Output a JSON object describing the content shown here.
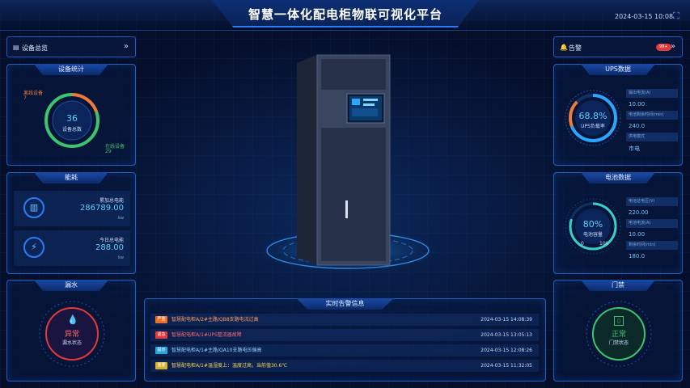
{
  "header": {
    "title": "智慧一体化配电柜物联可视化平台",
    "datetime": "2024-03-15 10:08"
  },
  "overview": {
    "label": "设备总览"
  },
  "device_stats": {
    "title": "设备统计",
    "total": "36",
    "total_label": "设备总数",
    "offline_label": "离线设备",
    "offline_count": "7",
    "online_label": "在线设备",
    "online_count": "29"
  },
  "energy": {
    "title": "能耗",
    "cumulative_label": "累加总电能",
    "cumulative_value": "286789.00",
    "cumulative_unit": "kw",
    "today_label": "今日总电能",
    "today_value": "288.00",
    "today_unit": "kw"
  },
  "leak": {
    "title": "漏水",
    "status": "异常",
    "status_label": "漏水状态"
  },
  "alarm": {
    "label": "告警",
    "badge": "99+"
  },
  "ups": {
    "title": "UPS数据",
    "percent": "68.8%",
    "percent_label": "UPS负载率",
    "fields": [
      {
        "label": "输出电流(A)",
        "value": "10.00"
      },
      {
        "label": "电池剩余时间(min)",
        "value": "240.0"
      },
      {
        "label": "供电模式",
        "value": "市电"
      }
    ]
  },
  "battery": {
    "title": "电池数据",
    "percent": "80%",
    "percent_label": "电池容量",
    "scale_min": "0",
    "scale_max": "100",
    "fields": [
      {
        "label": "电池总电压(V)",
        "value": "220.00"
      },
      {
        "label": "电池电流(A)",
        "value": "10.00"
      },
      {
        "label": "剩余时间(min)",
        "value": "180.0"
      }
    ]
  },
  "door": {
    "title": "门禁",
    "status": "正常",
    "status_label": "门禁状态"
  },
  "realtime": {
    "title": "实时告警信息",
    "rows": [
      {
        "tag": "严重",
        "color": "#e8722a",
        "text": "智慧配电柜A/2#主路/QB8支路电流过高",
        "time": "2024-03-15 14:08:39",
        "text_color": "#ff9e5a"
      },
      {
        "tag": "紧急",
        "color": "#e23a3a",
        "text": "智慧配电柜A/1#UPS整流器故障",
        "time": "2024-03-15 13:05:13",
        "text_color": "#ff6b6b"
      },
      {
        "tag": "提示",
        "color": "#2aa6d8",
        "text": "智慧配电柜A/1#主路/QA10支路电压偏高",
        "time": "2024-03-15 12:08:26",
        "text_color": "#8fd3ff"
      },
      {
        "tag": "重要",
        "color": "#d8b12a",
        "text": "智慧配电柜A/1#温湿度上：温度过高，当前值30.6℃",
        "time": "2024-03-15 11:32:05",
        "text_color": "#f2d25a"
      }
    ]
  }
}
